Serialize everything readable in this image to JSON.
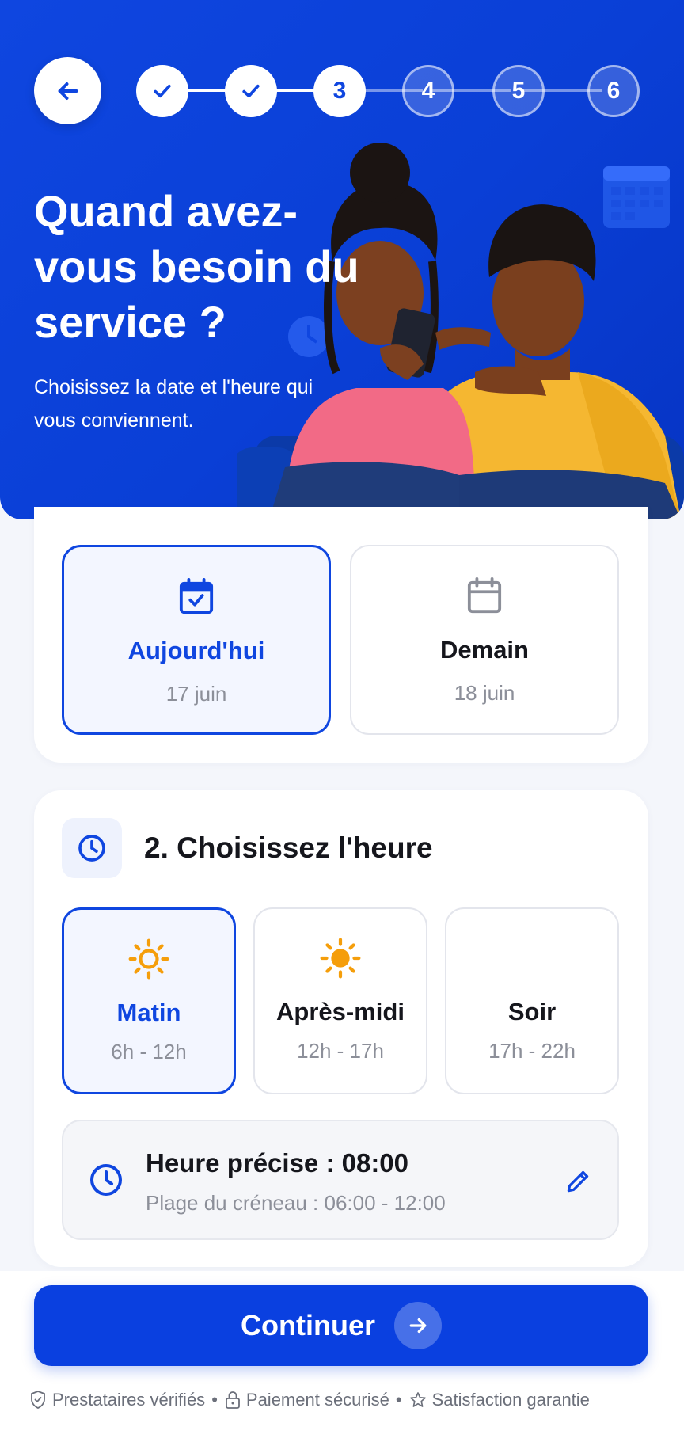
{
  "stepper": {
    "steps": [
      {
        "state": "done",
        "label": ""
      },
      {
        "state": "done",
        "label": ""
      },
      {
        "state": "current",
        "label": "3"
      },
      {
        "state": "todo",
        "label": "4"
      },
      {
        "state": "todo",
        "label": "5"
      },
      {
        "state": "todo",
        "label": "6"
      }
    ],
    "current_step": 3,
    "total_steps": 6
  },
  "hero": {
    "title": "Quand avez-vous besoin du service ?",
    "subtitle": "Choisissez la date et l'heure qui vous conviennent.",
    "illustration": "couple-looking-at-phone"
  },
  "date_section": {
    "options": [
      {
        "label": "Aujourd'hui",
        "sub": "17 juin",
        "icon": "calendar-check-icon",
        "selected": true
      },
      {
        "label": "Demain",
        "sub": "18 juin",
        "icon": "calendar-icon",
        "selected": false
      }
    ]
  },
  "time_section": {
    "title": "2. Choisissez l'heure",
    "options": [
      {
        "label": "Matin",
        "sub": "6h - 12h",
        "icon": "sun-outline-icon",
        "selected": true
      },
      {
        "label": "Après-midi",
        "sub": "12h - 17h",
        "icon": "sun-icon",
        "selected": false
      },
      {
        "label": "Soir",
        "sub": "17h - 22h",
        "icon": "moon-icon",
        "selected": false
      }
    ],
    "precise": {
      "title": "Heure précise : 08:00",
      "range": "Plage du créneau : 06:00 - 12:00"
    }
  },
  "footer": {
    "continue_label": "Continuer",
    "trust": [
      "Prestataires vérifiés",
      "Paiement sécurisé",
      "Satisfaction garantie"
    ]
  },
  "colors": {
    "primary": "#0F46E0",
    "accent_sun": "#F59E0B",
    "text": "#15161C",
    "muted": "#8C8F99"
  }
}
